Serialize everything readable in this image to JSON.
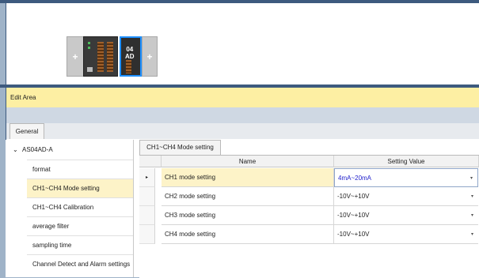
{
  "hardware": {
    "add_slot_label": "+",
    "module_label_line1": "04",
    "module_label_line2": "AD"
  },
  "edit_area": {
    "title": "Edit Area",
    "tab": "General"
  },
  "tree": {
    "root_toggle": "⌄",
    "root_label": "AS04AD-A",
    "items": [
      {
        "label": "format"
      },
      {
        "label": "CH1~CH4 Mode setting",
        "selected": true
      },
      {
        "label": "CH1~CH4 Calibration"
      },
      {
        "label": "average filter"
      },
      {
        "label": "sampling time"
      },
      {
        "label": "Channel Detect and Alarm settings"
      }
    ]
  },
  "grid": {
    "tab": "CH1~CH4 Mode setting",
    "columns": [
      "Name",
      "Setting Value"
    ],
    "row_indicator": "▸",
    "dropdown_glyph": "▾",
    "rows": [
      {
        "name": "CH1 mode setting",
        "value": "4mA~20mA"
      },
      {
        "name": "CH2 mode setting",
        "value": "-10V~+10V"
      },
      {
        "name": "CH3 mode setting",
        "value": "-10V~+10V"
      },
      {
        "name": "CH4 mode setting",
        "value": "-10V~+10V"
      }
    ]
  }
}
